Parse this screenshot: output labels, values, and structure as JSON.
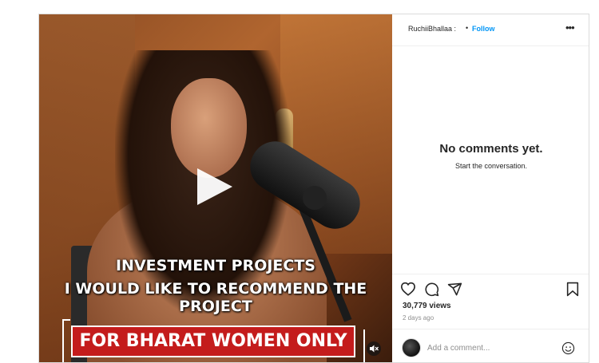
{
  "video": {
    "caption_line1": "INVESTMENT PROJECTS",
    "caption_line2": "I WOULD LIKE TO RECOMMEND THE PROJECT",
    "banner": "FOR  BHARAT WOMEN ONLY",
    "play_icon": "play-icon",
    "mute_icon": "muted-speaker-icon"
  },
  "header": {
    "username": "RuchiiBhallaa :",
    "separator": "•",
    "follow_label": "Follow",
    "more_label": "•••"
  },
  "comments": {
    "empty_title": "No comments yet.",
    "empty_subtitle": "Start the conversation."
  },
  "actions": {
    "icons": [
      "heart-icon",
      "comment-icon",
      "share-icon",
      "bookmark-icon"
    ],
    "views": "30,779 views",
    "posted": "2 days ago"
  },
  "composer": {
    "placeholder": "Add a comment...",
    "emoji_icon": "emoji-icon"
  },
  "colors": {
    "accent": "#0095f6",
    "banner": "#c41c1c",
    "border": "#dbdbdb"
  }
}
